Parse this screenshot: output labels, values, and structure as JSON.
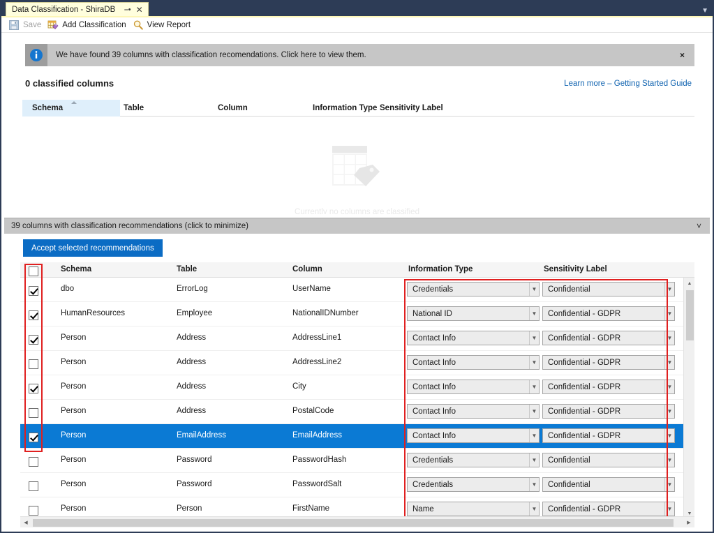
{
  "window": {
    "tab_title": "Data Classification - ShiraDB",
    "pin_icon": "pin-icon",
    "close_icon": "close-icon",
    "tabstrip_chevron": "chevron-down-icon"
  },
  "toolbar": {
    "save_label": "Save",
    "add_classification_label": "Add Classification",
    "view_report_label": "View Report"
  },
  "infobar": {
    "icon": "info-icon",
    "message": "We have found 39 columns with classification recomendations. Click here to view them.",
    "close_label": "×"
  },
  "classified": {
    "title": "0 classified columns",
    "learn_more": "Learn more – Getting Started Guide",
    "columns": [
      "Schema",
      "Table",
      "Column",
      "Information Type",
      "Sensitivity Label"
    ],
    "sorted_column": "Schema",
    "sort_direction": "ascending",
    "empty_text": "Currently no columns are classified",
    "empty_icon": "table-tag-icon"
  },
  "recommendations": {
    "header": "39 columns with classification recommendations (click to minimize)",
    "header_chevron": "chevron-down-icon",
    "accept_button": "Accept selected recommendations",
    "columns": [
      "Schema",
      "Table",
      "Column",
      "Information Type",
      "Sensitivity Label"
    ],
    "select_all_checked": false,
    "rows": [
      {
        "checked": true,
        "schema": "dbo",
        "table": "ErrorLog",
        "column": "UserName",
        "info_type": "Credentials",
        "sensitivity": "Confidential",
        "selected": false
      },
      {
        "checked": true,
        "schema": "HumanResources",
        "table": "Employee",
        "column": "NationalIDNumber",
        "info_type": "National ID",
        "sensitivity": "Confidential - GDPR",
        "selected": false
      },
      {
        "checked": true,
        "schema": "Person",
        "table": "Address",
        "column": "AddressLine1",
        "info_type": "Contact Info",
        "sensitivity": "Confidential - GDPR",
        "selected": false
      },
      {
        "checked": false,
        "schema": "Person",
        "table": "Address",
        "column": "AddressLine2",
        "info_type": "Contact Info",
        "sensitivity": "Confidential - GDPR",
        "selected": false
      },
      {
        "checked": true,
        "schema": "Person",
        "table": "Address",
        "column": "City",
        "info_type": "Contact Info",
        "sensitivity": "Confidential - GDPR",
        "selected": false
      },
      {
        "checked": false,
        "schema": "Person",
        "table": "Address",
        "column": "PostalCode",
        "info_type": "Contact Info",
        "sensitivity": "Confidential - GDPR",
        "selected": false
      },
      {
        "checked": true,
        "schema": "Person",
        "table": "EmailAddress",
        "column": "EmailAddress",
        "info_type": "Contact Info",
        "sensitivity": "Confidential - GDPR",
        "selected": true
      },
      {
        "checked": false,
        "schema": "Person",
        "table": "Password",
        "column": "PasswordHash",
        "info_type": "Credentials",
        "sensitivity": "Confidential",
        "selected": false
      },
      {
        "checked": false,
        "schema": "Person",
        "table": "Password",
        "column": "PasswordSalt",
        "info_type": "Credentials",
        "sensitivity": "Confidential",
        "selected": false
      },
      {
        "checked": false,
        "schema": "Person",
        "table": "Person",
        "column": "FirstName",
        "info_type": "Name",
        "sensitivity": "Confidential - GDPR",
        "selected": false
      }
    ]
  },
  "scrollbars": {
    "vertical_up": "▲",
    "vertical_down": "▼",
    "horizontal_left": "◀",
    "horizontal_right": "▶"
  },
  "colors": {
    "accent_blue": "#0b6cc4",
    "selected_row": "#0b7ad4",
    "link_blue": "#1063b0",
    "annotation_red": "#e02020",
    "tab_yellow": "#fffedd",
    "titlebar_navy": "#2d3c56",
    "infobar_gray": "#c6c6c6"
  }
}
